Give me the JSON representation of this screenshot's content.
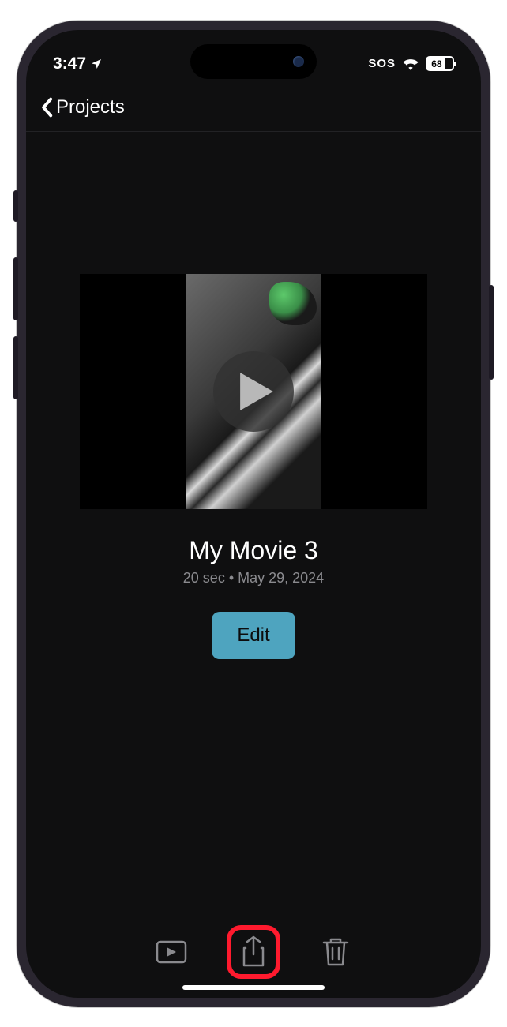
{
  "statusbar": {
    "time": "3:47",
    "sos": "SOS",
    "battery": "68"
  },
  "nav": {
    "back_label": "Projects"
  },
  "project": {
    "title": "My Movie 3",
    "meta": "20 sec • May 29, 2024",
    "edit_label": "Edit"
  }
}
